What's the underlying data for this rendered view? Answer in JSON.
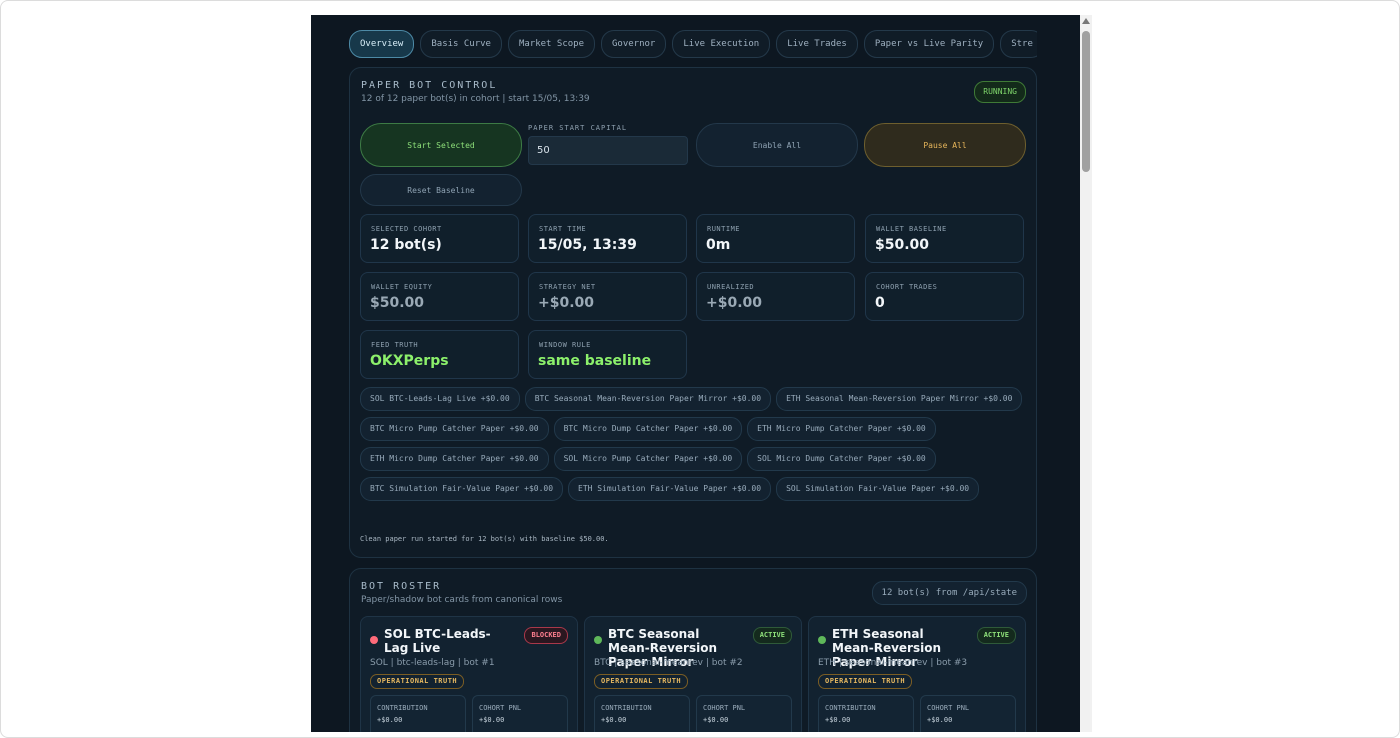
{
  "tabs": [
    "Overview",
    "Basis Curve",
    "Market Scope",
    "Governor",
    "Live Execution",
    "Live Trades",
    "Paper vs Live Parity",
    "Stre"
  ],
  "control": {
    "title": "PAPER BOT CONTROL",
    "subtitle": "12 of 12 paper bot(s) in cohort | start 15/05, 13:39",
    "status": "RUNNING",
    "start_label": "Start Selected",
    "capital_label": "PAPER START CAPITAL",
    "capital_value": "50",
    "enable_label": "Enable All",
    "pause_label": "Pause All",
    "reset_label": "Reset Baseline",
    "note": "Clean paper run started for 12 bot(s) with baseline $50.00."
  },
  "stats": [
    {
      "label": "SELECTED COHORT",
      "value": "12 bot(s)"
    },
    {
      "label": "START TIME",
      "value": "15/05, 13:39"
    },
    {
      "label": "RUNTIME",
      "value": "0m"
    },
    {
      "label": "WALLET BASELINE",
      "value": "$50.00"
    },
    {
      "label": "WALLET EQUITY",
      "value": "$50.00"
    },
    {
      "label": "STRATEGY NET",
      "value": "+$0.00"
    },
    {
      "label": "UNREALIZED",
      "value": "+$0.00"
    },
    {
      "label": "COHORT TRADES",
      "value": "0"
    },
    {
      "label": "FEED TRUTH",
      "value": "OKXPerps"
    },
    {
      "label": "WINDOW RULE",
      "value": "same baseline"
    }
  ],
  "chips": [
    "SOL BTC-Leads-Lag Live +$0.00",
    "BTC Seasonal Mean-Reversion Paper Mirror +$0.00",
    "ETH Seasonal Mean-Reversion Paper Mirror +$0.00",
    "BTC Micro Pump Catcher Paper +$0.00",
    "BTC Micro Dump Catcher Paper +$0.00",
    "ETH Micro Pump Catcher Paper +$0.00",
    "ETH Micro Dump Catcher Paper +$0.00",
    "SOL Micro Pump Catcher Paper +$0.00",
    "SOL Micro Dump Catcher Paper +$0.00",
    "BTC Simulation Fair-Value Paper +$0.00",
    "ETH Simulation Fair-Value Paper +$0.00",
    "SOL Simulation Fair-Value Paper +$0.00"
  ],
  "roster": {
    "title": "BOT ROSTER",
    "subtitle": "Paper/shadow bot cards from canonical rows",
    "badge": "12 bot(s) from /api/state",
    "bots": [
      {
        "name": "SOL BTC-Leads-Lag Live",
        "status": "BLOCKED",
        "meta": "SOL | btc-leads-lag | bot #1",
        "truth": "OPERATIONAL TRUTH",
        "contribution_label": "CONTRIBUTION",
        "contribution": "+$0.00",
        "pnl_label": "COHORT PNL",
        "pnl": "+$0.00"
      },
      {
        "name": "BTC Seasonal Mean-Reversion Paper Mirror",
        "status": "ACTIVE",
        "meta": "BTC | seasonal-meanrev | bot #2",
        "truth": "OPERATIONAL TRUTH",
        "contribution_label": "CONTRIBUTION",
        "contribution": "+$0.00",
        "pnl_label": "COHORT PNL",
        "pnl": "+$0.00"
      },
      {
        "name": "ETH Seasonal Mean-Reversion Paper Mirror",
        "status": "ACTIVE",
        "meta": "ETH | seasonal-meanrev | bot #3",
        "truth": "OPERATIONAL TRUTH",
        "contribution_label": "CONTRIBUTION",
        "contribution": "+$0.00",
        "pnl_label": "COHORT PNL",
        "pnl": "+$0.00"
      }
    ]
  }
}
